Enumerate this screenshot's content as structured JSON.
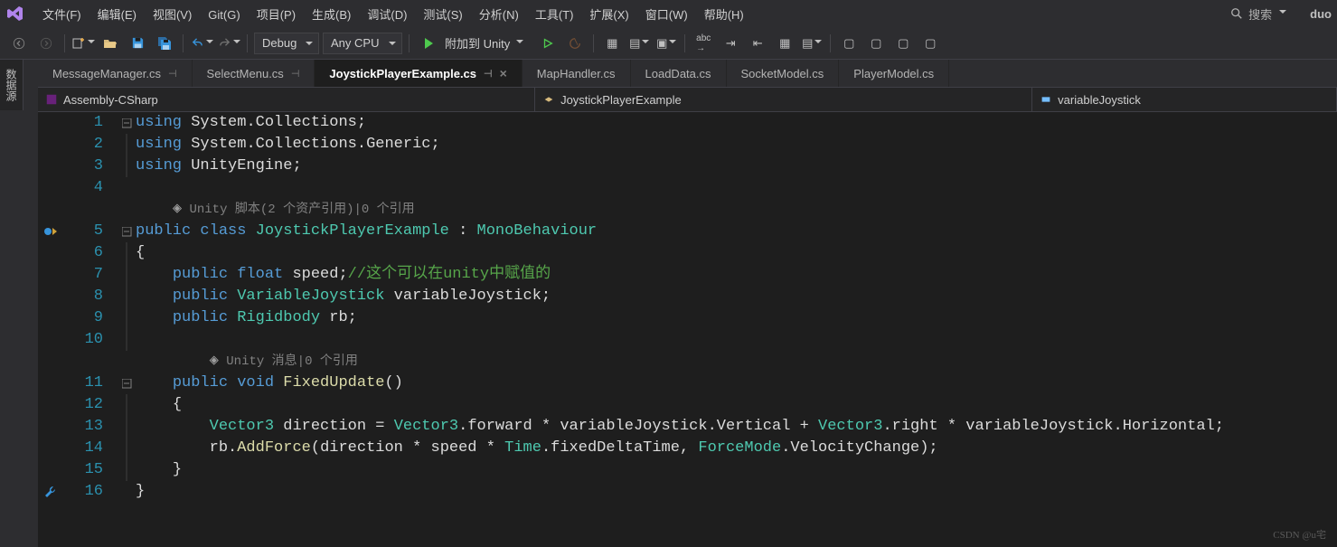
{
  "menubar": {
    "items": [
      "文件(F)",
      "编辑(E)",
      "视图(V)",
      "Git(G)",
      "项目(P)",
      "生成(B)",
      "调试(D)",
      "测试(S)",
      "分析(N)",
      "工具(T)",
      "扩展(X)",
      "窗口(W)",
      "帮助(H)"
    ],
    "search_placeholder": "搜索",
    "username": "duo"
  },
  "toolbar": {
    "config": "Debug",
    "platform": "Any CPU",
    "run_label": "附加到 Unity"
  },
  "side_tab": "数据源",
  "tabs": [
    {
      "label": "MessageManager.cs",
      "pinned": true,
      "active": false,
      "closeable": false
    },
    {
      "label": "SelectMenu.cs",
      "pinned": true,
      "active": false,
      "closeable": false
    },
    {
      "label": "JoystickPlayerExample.cs",
      "pinned": true,
      "active": true,
      "closeable": true
    },
    {
      "label": "MapHandler.cs",
      "pinned": false,
      "active": false,
      "closeable": false
    },
    {
      "label": "LoadData.cs",
      "pinned": false,
      "active": false,
      "closeable": false
    },
    {
      "label": "SocketModel.cs",
      "pinned": false,
      "active": false,
      "closeable": false
    },
    {
      "label": "PlayerModel.cs",
      "pinned": false,
      "active": false,
      "closeable": false
    }
  ],
  "navbar": {
    "project": "Assembly-CSharp",
    "class": "JoystickPlayerExample",
    "member": "variableJoystick"
  },
  "code": {
    "lines": [
      {
        "n": 1,
        "fold": "-",
        "html": "<span class='kw'>using</span> <span class='id'>System</span><span class='pun'>.</span><span class='id'>Collections</span><span class='pun'>;</span>"
      },
      {
        "n": 2,
        "fold": "|",
        "html": "<span class='kw'>using</span> <span class='id'>System</span><span class='pun'>.</span><span class='id'>Collections</span><span class='pun'>.</span><span class='id'>Generic</span><span class='pun'>;</span>"
      },
      {
        "n": 3,
        "fold": "|",
        "html": "<span class='kw'>using</span> <span class='id'>UnityEngine</span><span class='pun'>;</span>"
      },
      {
        "n": 4,
        "fold": "",
        "html": ""
      },
      {
        "n": "",
        "hint": true,
        "ind": 1,
        "html": "<span class='hint-ico'>◈</span><span class='hint'> Unity 脚本(2 个资产引用)|0 个引用</span>"
      },
      {
        "n": 5,
        "fold": "-",
        "glyph": "impl",
        "html": "<span class='kw'>public</span> <span class='kw'>class</span> <span class='type'>JoystickPlayerExample</span> <span class='pun'>:</span> <span class='type'>MonoBehaviour</span>"
      },
      {
        "n": 6,
        "fold": "|",
        "html": "<span class='pun'>{</span>"
      },
      {
        "n": 7,
        "fold": "|",
        "ind": 1,
        "html": "<span class='kw'>public</span> <span class='kw'>float</span> <span class='id'>speed</span><span class='pun'>;</span><span class='cmt'>//这个可以在unity中赋值的</span>"
      },
      {
        "n": 8,
        "fold": "|",
        "ind": 1,
        "html": "<span class='kw'>public</span> <span class='type'>VariableJoystick</span> <span class='id'>variableJoystick</span><span class='pun'>;</span>"
      },
      {
        "n": 9,
        "fold": "|",
        "ind": 1,
        "html": "<span class='kw'>public</span> <span class='type'>Rigidbody</span> <span class='id'>rb</span><span class='pun'>;</span>"
      },
      {
        "n": 10,
        "fold": "|",
        "html": ""
      },
      {
        "n": "",
        "hint": true,
        "ind": 2,
        "html": "<span class='hint-ico'>◈</span><span class='hint'> Unity 消息|0 个引用</span>"
      },
      {
        "n": 11,
        "fold": "-",
        "ind": 1,
        "html": "<span class='kw'>public</span> <span class='kw'>void</span> <span class='fn'>FixedUpdate</span><span class='pun'>()</span>"
      },
      {
        "n": 12,
        "fold": "|",
        "ind": 1,
        "html": "<span class='pun'>{</span>"
      },
      {
        "n": 13,
        "fold": "|",
        "ind": 2,
        "html": "<span class='type'>Vector3</span> <span class='id'>direction</span> <span class='pun'>=</span> <span class='type'>Vector3</span><span class='pun'>.</span><span class='id'>forward</span> <span class='pun'>*</span> <span class='id'>variableJoystick</span><span class='pun'>.</span><span class='id'>Vertical</span> <span class='pun'>+</span> <span class='type'>Vector3</span><span class='pun'>.</span><span class='id'>right</span> <span class='pun'>*</span> <span class='id'>variableJoystick</span><span class='pun'>.</span><span class='id'>Horizontal</span><span class='pun'>;</span>"
      },
      {
        "n": 14,
        "fold": "|",
        "ind": 2,
        "html": "<span class='id'>rb</span><span class='pun'>.</span><span class='fn'>AddForce</span><span class='pun'>(</span><span class='id'>direction</span> <span class='pun'>*</span> <span class='id'>speed</span> <span class='pun'>*</span> <span class='type'>Time</span><span class='pun'>.</span><span class='id'>fixedDeltaTime</span><span class='pun'>,</span> <span class='type'>ForceMode</span><span class='pun'>.</span><span class='id'>VelocityChange</span><span class='pun'>);</span>"
      },
      {
        "n": 15,
        "fold": "|",
        "ind": 1,
        "html": "<span class='pun'>}</span>"
      },
      {
        "n": 16,
        "fold": "",
        "glyph": "wrench",
        "html": "<span class='pun'>}</span>"
      }
    ]
  },
  "watermark": "CSDN @u宅"
}
